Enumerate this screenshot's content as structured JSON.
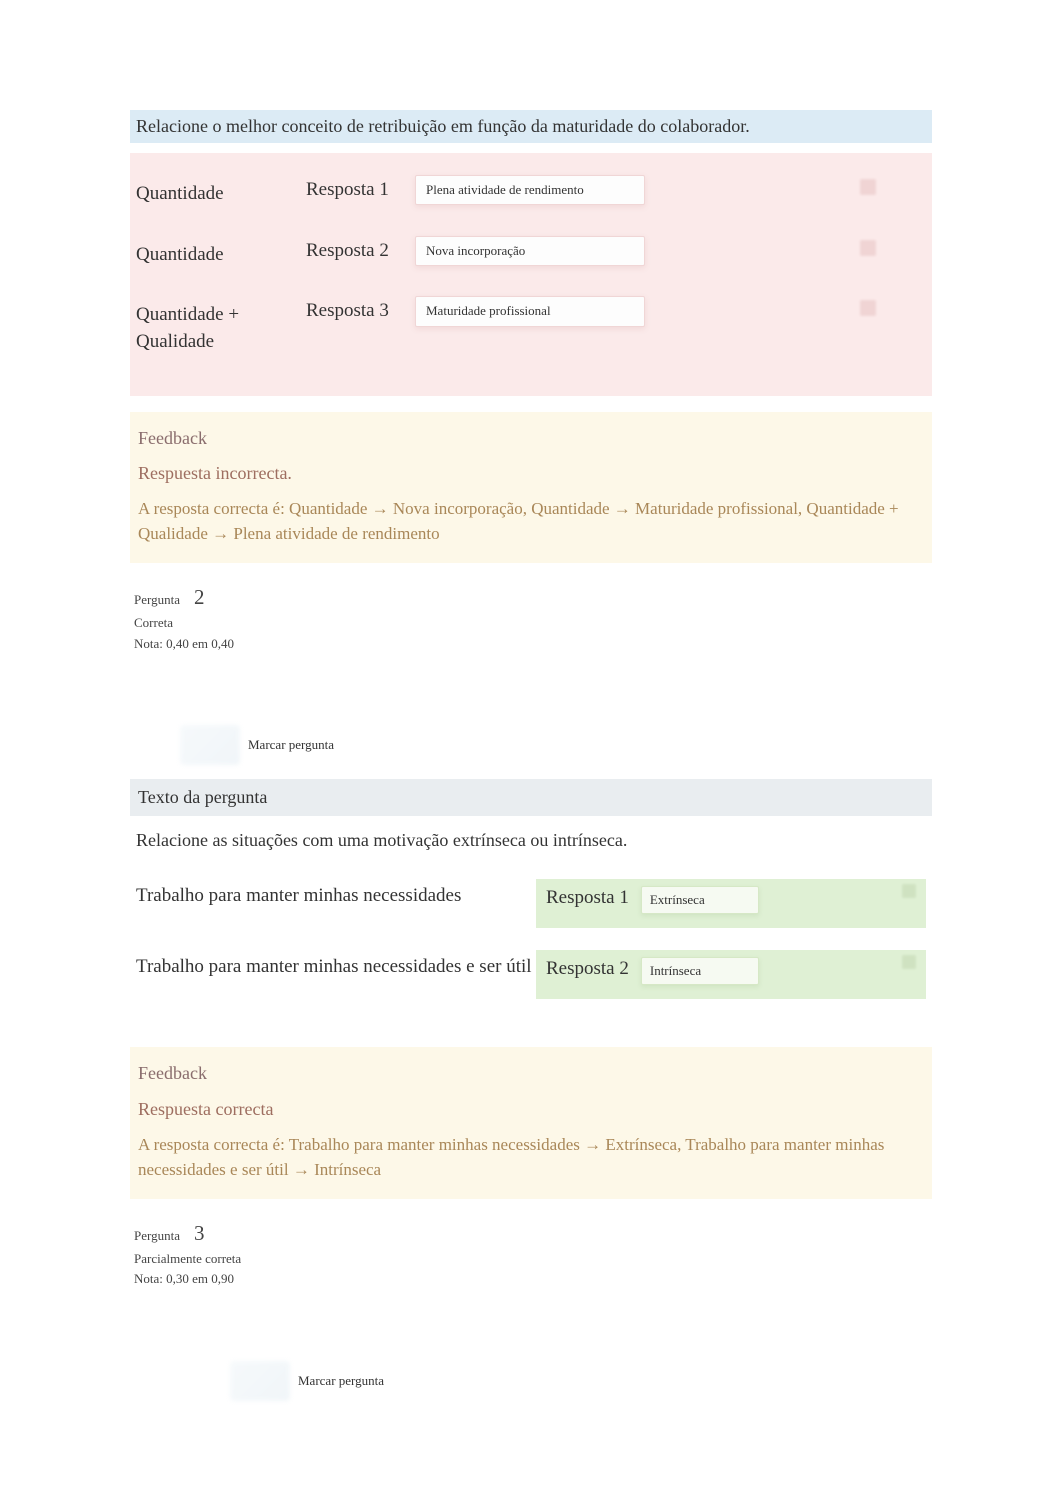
{
  "q1": {
    "instruction": "Relacione o melhor conceito de retribuição em função da maturidade do colaborador.",
    "rows": [
      {
        "prompt": "Quantidade",
        "resposta": "Resposta 1",
        "selected": "Plena atividade de rendimento"
      },
      {
        "prompt": "Quantidade",
        "resposta": "Resposta 2",
        "selected": "Nova incorporação"
      },
      {
        "prompt": "Quantidade + Qualidade",
        "resposta": "Resposta 3",
        "selected": "Maturidade profissional"
      }
    ],
    "feedback": {
      "label": "Feedback",
      "status": "Respuesta incorrecta.",
      "answer": "A resposta correcta é: Quantidade → Nova incorporação, Quantidade → Maturidade profissional, Quantidade + Qualidade → Plena atividade de rendimento"
    }
  },
  "q2": {
    "meta": {
      "pergunta_label": "Pergunta",
      "number": "2",
      "status": "Correta",
      "grade": "Nota: 0,40 em 0,40"
    },
    "flag_label": "Marcar pergunta",
    "text_label": "Texto da pergunta",
    "instruction": "Relacione as situações com uma motivação extrínseca ou intrínseca.",
    "rows": [
      {
        "prompt": "Trabalho para manter minhas necessidades",
        "resposta": "Resposta 1",
        "selected": "Extrínseca"
      },
      {
        "prompt": "Trabalho para manter minhas necessidades e ser útil",
        "resposta": "Resposta 2",
        "selected": "Intrínseca"
      }
    ],
    "feedback": {
      "label": "Feedback",
      "status": "Respuesta correcta",
      "answer": "A resposta correcta é: Trabalho para manter minhas necessidades → Extrínseca, Trabalho para manter minhas necessidades e ser útil → Intrínseca"
    }
  },
  "q3": {
    "meta": {
      "pergunta_label": "Pergunta",
      "number": "3",
      "status": "Parcialmente correta",
      "grade": "Nota: 0,30 em 0,90"
    },
    "flag_label": "Marcar pergunta"
  }
}
